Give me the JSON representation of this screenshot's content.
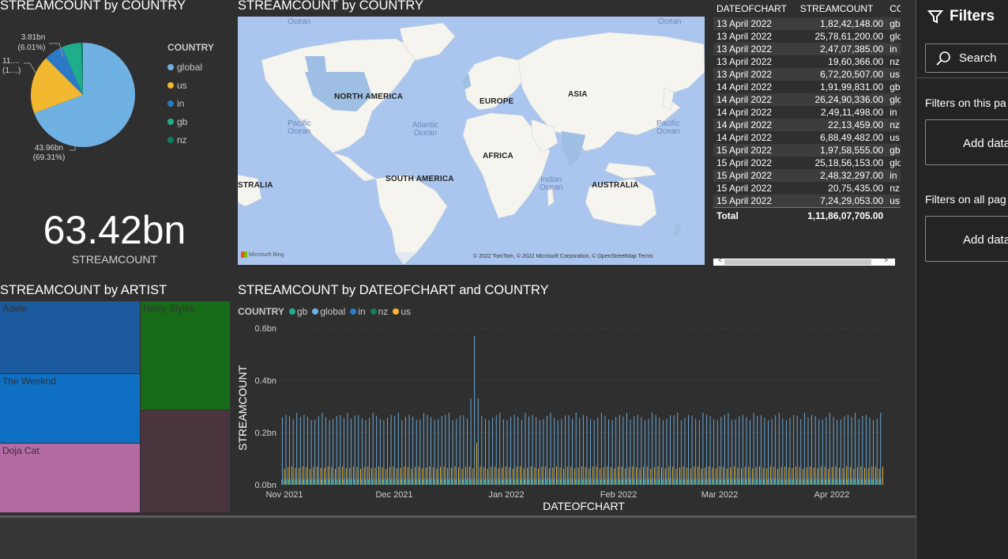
{
  "pie": {
    "title": "STREAMCOUNT by COUNTRY",
    "legend_title": "COUNTRY",
    "legend": [
      {
        "label": "global",
        "color": "#6fb1e3"
      },
      {
        "label": "us",
        "color": "#f2b82f"
      },
      {
        "label": "in",
        "color": "#2c7ac7"
      },
      {
        "label": "gb",
        "color": "#1fae8b"
      },
      {
        "label": "nz",
        "color": "#117a62"
      }
    ],
    "label_top_value": "3.81bn",
    "label_top_pct": "(6.01%)",
    "label_left_value": "11....",
    "label_left_pct": "(1....)",
    "label_bottom_value": "43.96bn",
    "label_bottom_pct": "(69.31%)"
  },
  "card": {
    "value": "63.42bn",
    "label": "STREAMCOUNT"
  },
  "map": {
    "title": "STREAMCOUNT by COUNTRY",
    "labels": {
      "north_america": "NORTH AMERICA",
      "south_america": "SOUTH AMERICA",
      "europe": "EUROPE",
      "asia": "ASIA",
      "africa": "AFRICA",
      "australia": "AUSTRALIA",
      "australia_left": "STRALIA"
    },
    "oceans": {
      "top_left": "Ocean",
      "top_right": "Ocean",
      "pacific_left": "Pacific\nOcean",
      "atlantic": "Atlantic\nOcean",
      "pacific_right": "Pacific\nOcean",
      "indian": "Indian\nOcean"
    },
    "logo": "Microsoft Bing",
    "attribution": "© 2022 TomTom, © 2022 Microsoft Corporation, © OpenStreetMap  Terms"
  },
  "table": {
    "headers": [
      "DATEOFCHART",
      "STREAMCOUNT",
      "COU"
    ],
    "rows": [
      [
        "13 April 2022",
        "1,82,42,148.00",
        "gb"
      ],
      [
        "13 April 2022",
        "25,78,61,200.00",
        "globa"
      ],
      [
        "13 April 2022",
        "2,47,07,385.00",
        "in"
      ],
      [
        "13 April 2022",
        "19,60,366.00",
        "nz"
      ],
      [
        "13 April 2022",
        "6,72,20,507.00",
        "us"
      ],
      [
        "14 April 2022",
        "1,91,99,831.00",
        "gb"
      ],
      [
        "14 April 2022",
        "26,24,90,336.00",
        "globa"
      ],
      [
        "14 April 2022",
        "2,49,11,498.00",
        "in"
      ],
      [
        "14 April 2022",
        "22,13,459.00",
        "nz"
      ],
      [
        "14 April 2022",
        "6,88,49,482.00",
        "us"
      ],
      [
        "15 April 2022",
        "1,97,58,555.00",
        "gb"
      ],
      [
        "15 April 2022",
        "25,18,56,153.00",
        "globa"
      ],
      [
        "15 April 2022",
        "2,48,32,297.00",
        "in"
      ],
      [
        "15 April 2022",
        "20,75,435.00",
        "nz"
      ],
      [
        "15 April 2022",
        "7,24,29,053.00",
        "us"
      ]
    ],
    "total_label": "Total",
    "total_value": "1,11,86,07,705.00",
    "scroll_left": "<",
    "scroll_right": ">"
  },
  "treemap": {
    "title": "STREAMCOUNT by ARTIST",
    "tiles": [
      {
        "label": "Adele",
        "color": "#1b5a9c"
      },
      {
        "label": "Harry Styles",
        "color": "#176a17"
      },
      {
        "label": "The Weeknd",
        "color": "#0f6fc2"
      },
      {
        "label": "",
        "color": "#4a353e"
      },
      {
        "label": "Doja Cat",
        "color": "#b36ba2"
      }
    ]
  },
  "colchart": {
    "title": "STREAMCOUNT by DATEOFCHART and COUNTRY",
    "legend_title": "COUNTRY",
    "legend": [
      {
        "label": "gb",
        "color": "#1fae8b"
      },
      {
        "label": "global",
        "color": "#6fb1e3"
      },
      {
        "label": "in",
        "color": "#2c7ac7"
      },
      {
        "label": "nz",
        "color": "#117a62"
      },
      {
        "label": "us",
        "color": "#f2b82f"
      }
    ],
    "ylabel": "STREAMCOUNT",
    "xlabel": "DATEOFCHART",
    "yticks": [
      "0.0bn",
      "0.2bn",
      "0.4bn",
      "0.6bn"
    ],
    "xticks": [
      "Nov 2021",
      "Dec 2021",
      "Jan 2022",
      "Feb 2022",
      "Mar 2022",
      "Apr 2022"
    ]
  },
  "filters": {
    "title": "Filters",
    "search_placeholder": "Search",
    "section_page": "Filters on this pa",
    "add_data_1": "Add data",
    "section_all": "Filters on all pag",
    "add_data_2": "Add data"
  },
  "chart_data": [
    {
      "type": "pie",
      "title": "STREAMCOUNT by COUNTRY",
      "categories": [
        "global",
        "us",
        "in",
        "gb",
        "nz"
      ],
      "values": [
        43.96,
        11.5,
        3.81,
        3.8,
        0.35
      ],
      "unit": "bn",
      "percent": [
        69.31,
        18.1,
        6.01,
        6.0,
        0.55
      ]
    },
    {
      "type": "bar",
      "title": "STREAMCOUNT by DATEOFCHART and COUNTRY",
      "xlabel": "DATEOFCHART",
      "ylabel": "STREAMCOUNT",
      "ylim": [
        0,
        0.6
      ],
      "x_range": [
        "2021-11-01",
        "2022-04-15"
      ],
      "series": [
        {
          "name": "global",
          "typical_value": 0.26,
          "peak_value": 0.57,
          "peak_date": "2021-12-24"
        },
        {
          "name": "us",
          "typical_value": 0.067,
          "peak_value": 0.16,
          "peak_date": "2021-12-24"
        },
        {
          "name": "in",
          "typical_value": 0.025
        },
        {
          "name": "gb",
          "typical_value": 0.019
        },
        {
          "name": "nz",
          "typical_value": 0.002
        }
      ]
    }
  ]
}
